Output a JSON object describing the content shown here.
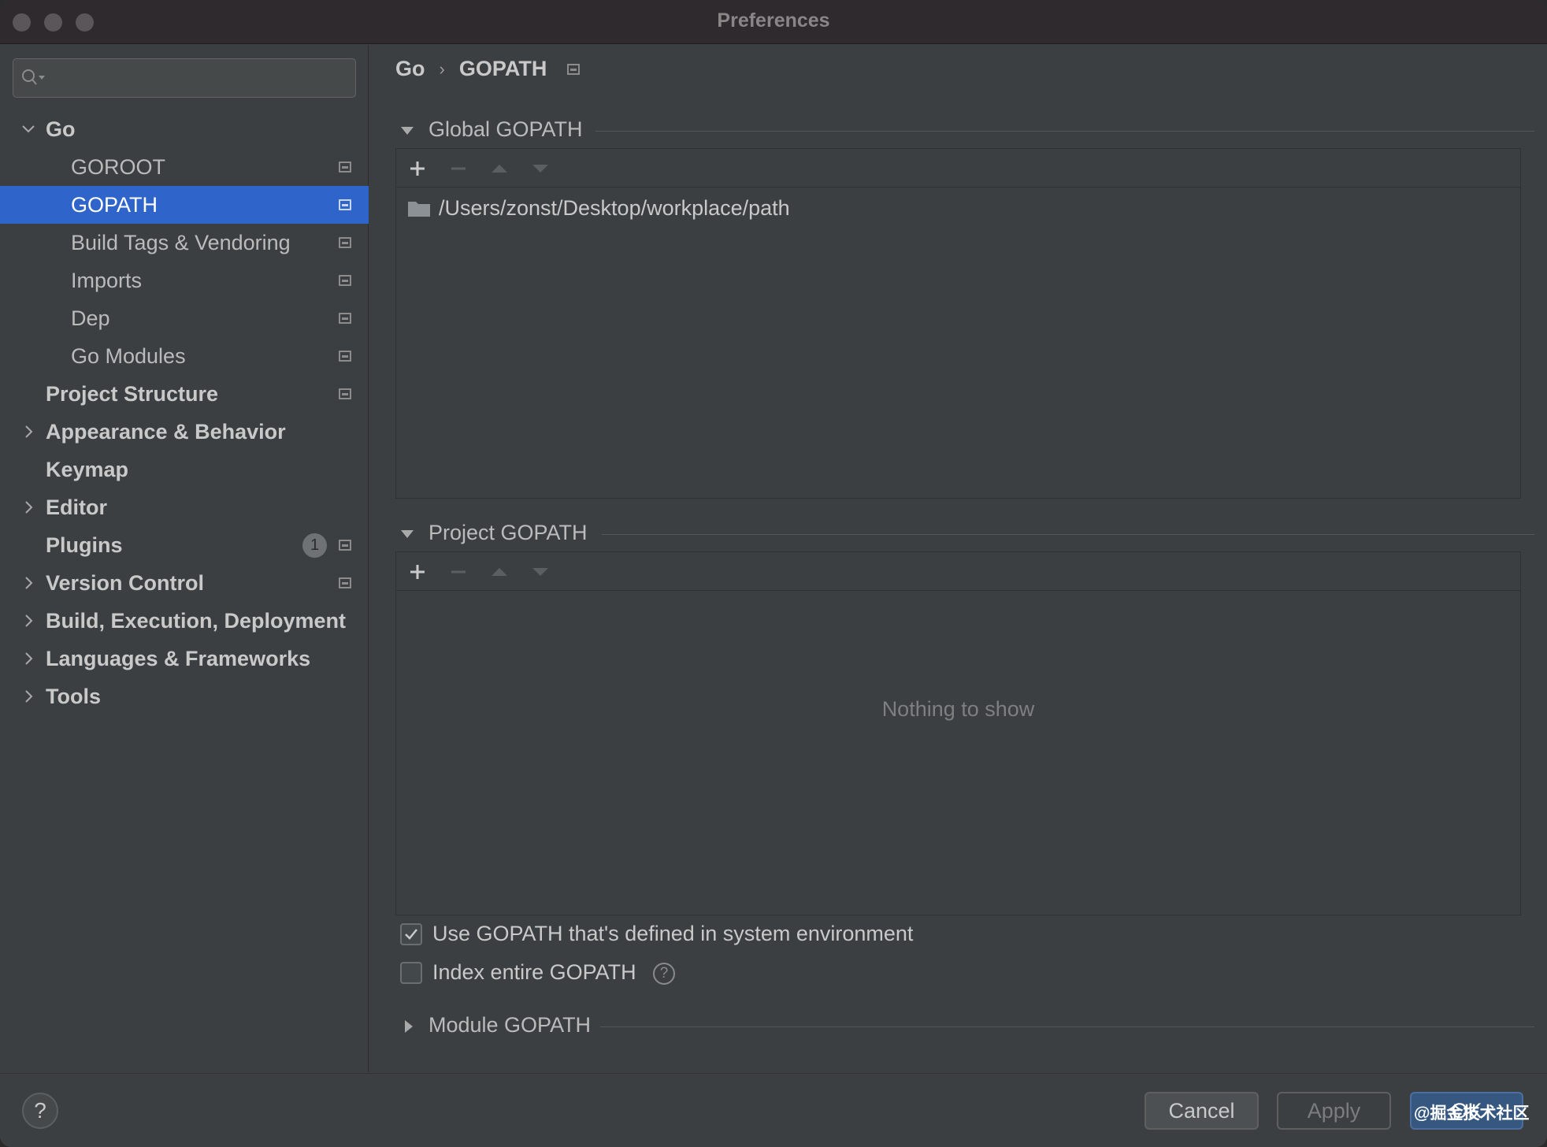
{
  "window": {
    "title": "Preferences"
  },
  "sidebar": {
    "search_placeholder": "",
    "items": [
      {
        "label": "Go",
        "level": 0,
        "expanded": true,
        "bold": true
      },
      {
        "label": "GOROOT",
        "level": 1
      },
      {
        "label": "GOPATH",
        "level": 1,
        "selected": true
      },
      {
        "label": "Build Tags & Vendoring",
        "level": 1
      },
      {
        "label": "Imports",
        "level": 1
      },
      {
        "label": "Dep",
        "level": 1
      },
      {
        "label": "Go Modules",
        "level": 1
      },
      {
        "label": "Project Structure",
        "level": 0,
        "bold": true
      },
      {
        "label": "Appearance & Behavior",
        "level": 0,
        "bold": true,
        "collapsed": true
      },
      {
        "label": "Keymap",
        "level": 0,
        "bold": true
      },
      {
        "label": "Editor",
        "level": 0,
        "bold": true,
        "collapsed": true
      },
      {
        "label": "Plugins",
        "level": 0,
        "bold": true,
        "badge": "1"
      },
      {
        "label": "Version Control",
        "level": 0,
        "bold": true,
        "collapsed": true
      },
      {
        "label": "Build, Execution, Deployment",
        "level": 0,
        "bold": true,
        "collapsed": true
      },
      {
        "label": "Languages & Frameworks",
        "level": 0,
        "bold": true,
        "collapsed": true
      },
      {
        "label": "Tools",
        "level": 0,
        "bold": true,
        "collapsed": true
      }
    ]
  },
  "breadcrumb": {
    "parent": "Go",
    "separator": "›",
    "current": "GOPATH"
  },
  "global_gopath": {
    "title": "Global GOPATH",
    "paths": [
      "/Users/zonst/Desktop/workplace/path"
    ]
  },
  "project_gopath": {
    "title": "Project GOPATH",
    "empty_text": "Nothing to show"
  },
  "options": {
    "use_system_gopath": {
      "label": "Use GOPATH that's defined in system environment",
      "checked": true
    },
    "index_entire_gopath": {
      "label": "Index entire GOPATH",
      "checked": false,
      "help": "?"
    }
  },
  "module_gopath": {
    "title": "Module GOPATH"
  },
  "footer": {
    "help": "?",
    "cancel": "Cancel",
    "apply": "Apply",
    "ok": "OK",
    "watermark": "@掘金技术社区"
  },
  "colors": {
    "accent": "#2f65ca",
    "background": "#3c3f41",
    "ok_button": "#365880"
  }
}
